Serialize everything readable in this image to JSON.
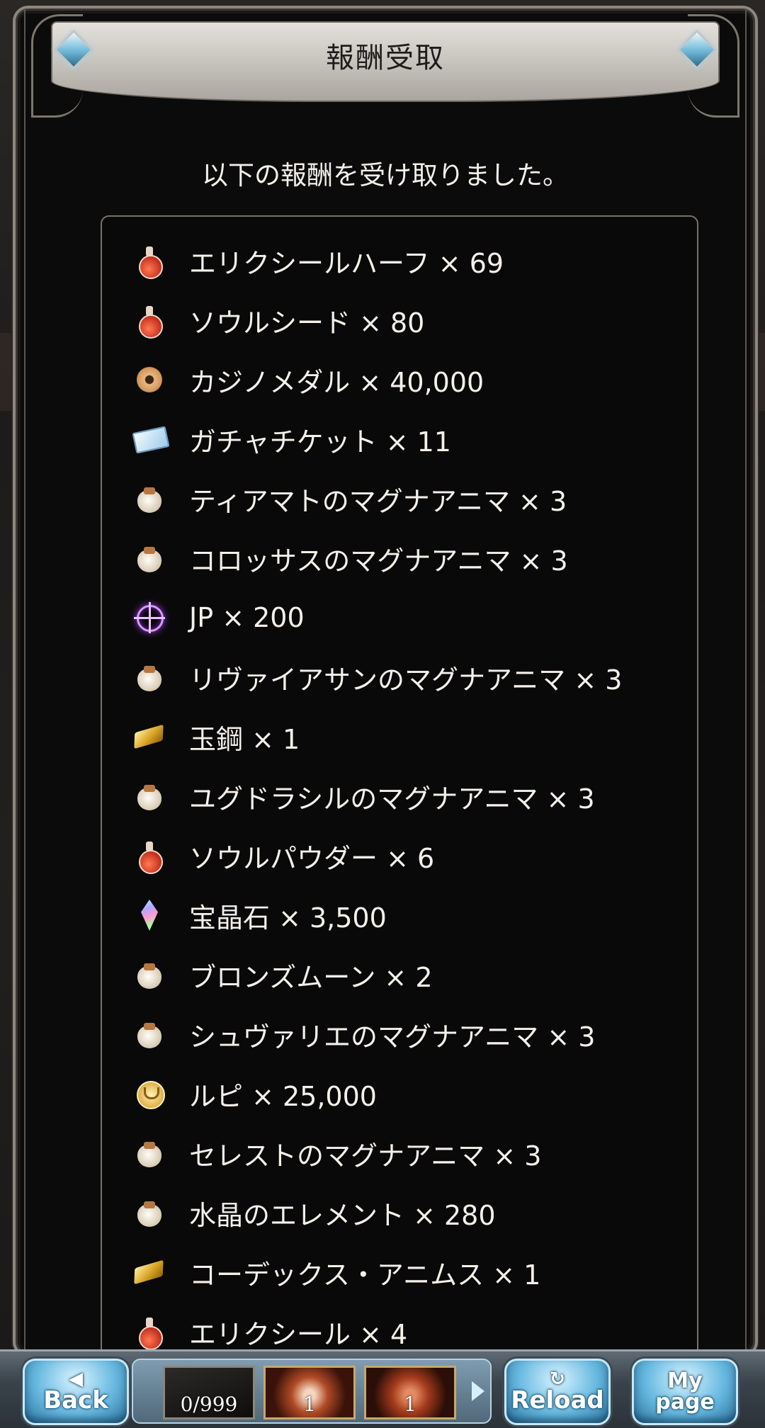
{
  "dialog": {
    "title": "報酬受取",
    "message": "以下の報酬を受け取りました。"
  },
  "rewards": [
    {
      "icon": "potion-icon",
      "text": "エリクシールハーフ × 69"
    },
    {
      "icon": "potion-icon",
      "text": "ソウルシード × 80"
    },
    {
      "icon": "casino-medal-icon",
      "text": "カジノメダル × 40,000"
    },
    {
      "icon": "ticket-icon",
      "text": "ガチャチケット × 11"
    },
    {
      "icon": "item-bag-icon",
      "text": "ティアマトのマグナアニマ × 3"
    },
    {
      "icon": "item-bag-icon",
      "text": "コロッサスのマグナアニマ × 3"
    },
    {
      "icon": "jp-crosshair-icon",
      "text": "JP × 200"
    },
    {
      "icon": "item-bag-icon",
      "text": "リヴァイアサンのマグナアニマ × 3"
    },
    {
      "icon": "gold-ingot-icon",
      "text": "玉鋼 × 1"
    },
    {
      "icon": "item-bag-icon",
      "text": "ユグドラシルのマグナアニマ × 3"
    },
    {
      "icon": "potion-icon",
      "text": "ソウルパウダー × 6"
    },
    {
      "icon": "crystal-icon",
      "text": "宝晶石 × 3,500"
    },
    {
      "icon": "item-bag-icon",
      "text": "ブロンズムーン × 2"
    },
    {
      "icon": "item-bag-icon",
      "text": "シュヴァリエのマグナアニマ × 3"
    },
    {
      "icon": "rupie-coin-icon",
      "text": "ルピ × 25,000"
    },
    {
      "icon": "item-bag-icon",
      "text": "セレストのマグナアニマ × 3"
    },
    {
      "icon": "item-bag-icon",
      "text": "水晶のエレメント × 280"
    },
    {
      "icon": "gold-ingot-icon",
      "text": "コーデックス・アニムス × 1"
    },
    {
      "icon": "potion-icon",
      "text": "エリクシール × 4"
    }
  ],
  "bottom_nav": {
    "back_label": "Back",
    "reload_label": "Reload",
    "mypage_label_line1": "My",
    "mypage_label_line2": "page",
    "slots": [
      {
        "count": "0/999"
      },
      {
        "count": "1"
      },
      {
        "count": "1"
      }
    ]
  }
}
